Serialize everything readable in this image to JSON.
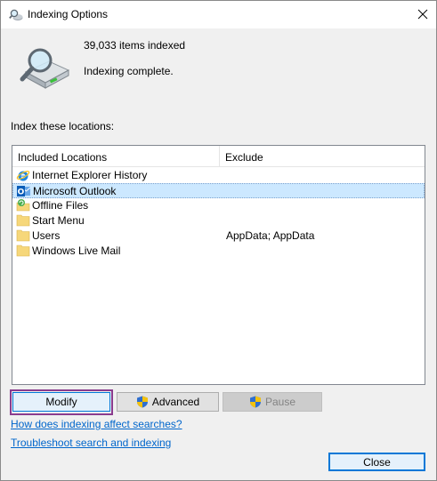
{
  "window": {
    "title": "Indexing Options",
    "close_glyph": "✕"
  },
  "summary": {
    "items_indexed": "39,033 items indexed",
    "status": "Indexing complete."
  },
  "locations": {
    "label": "Index these locations:",
    "columns": [
      "Included Locations",
      "Exclude"
    ],
    "rows": [
      {
        "name": "Internet Explorer History",
        "exclude": "",
        "icon": "internet-explorer-icon",
        "selected": false
      },
      {
        "name": "Microsoft Outlook",
        "exclude": "",
        "icon": "outlook-icon",
        "selected": true
      },
      {
        "name": "Offline Files",
        "exclude": "",
        "icon": "offline-files-icon",
        "selected": false
      },
      {
        "name": "Start Menu",
        "exclude": "",
        "icon": "folder-icon",
        "selected": false
      },
      {
        "name": "Users",
        "exclude": "AppData; AppData",
        "icon": "folder-icon",
        "selected": false
      },
      {
        "name": "Windows Live Mail",
        "exclude": "",
        "icon": "folder-icon",
        "selected": false
      }
    ]
  },
  "buttons": {
    "modify": "Modify",
    "advanced": "Advanced",
    "pause": "Pause",
    "close": "Close"
  },
  "links": {
    "how_affect": "How does indexing affect searches?",
    "troubleshoot": "Troubleshoot search and indexing"
  },
  "colors": {
    "link": "#0066cc",
    "selection": "#cce8ff",
    "focus_ring": "#8a3c8e",
    "folder": "#f6d77a"
  }
}
